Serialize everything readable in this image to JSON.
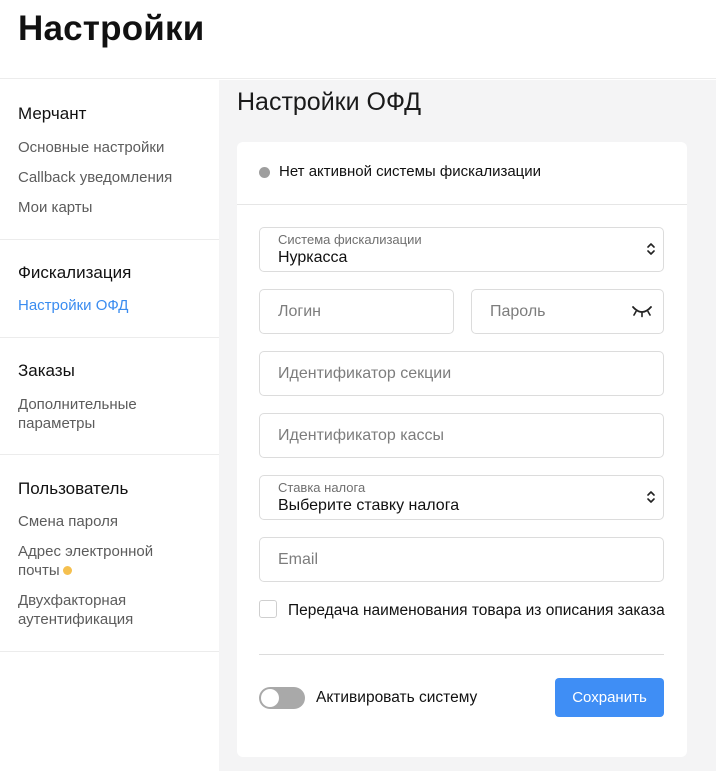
{
  "header": {
    "title": "Настройки"
  },
  "sidebar": {
    "sections": [
      {
        "heading": "Мерчант",
        "items": [
          "Основные настройки",
          "Callback уведомления",
          "Мои карты"
        ]
      },
      {
        "heading": "Фискализация",
        "items": [
          "Настройки ОФД"
        ]
      },
      {
        "heading": "Заказы",
        "items": [
          "Дополнительные параметры"
        ]
      },
      {
        "heading": "Пользователь",
        "items": [
          "Смена пароля",
          "Адрес электронной почты",
          "Двухфакторная аутентификация"
        ]
      }
    ],
    "active_item": "Настройки ОФД",
    "item_lines": {
      "zakazy_1_l1": "Дополнительные",
      "zakazy_1_l2": "параметры",
      "email_l1": "Адрес электронной",
      "email_l2": "почты",
      "twofa_l1": "Двухфакторная",
      "twofa_l2": "аутентификация"
    },
    "warning_dot_color": "#f5c04f"
  },
  "main": {
    "title": "Настройки ОФД",
    "status": {
      "text": "Нет активной системы фискализации",
      "dot_color": "#9e9e9e"
    },
    "form": {
      "fiscal_system": {
        "label": "Система фискализации",
        "value": "Нуркасса"
      },
      "login": {
        "placeholder": "Логин"
      },
      "password": {
        "placeholder": "Пароль"
      },
      "section_id": {
        "placeholder": "Идентификатор секции"
      },
      "cashbox_id": {
        "placeholder": "Идентификатор кассы"
      },
      "tax_rate": {
        "label": "Ставка налога",
        "value": "Выберите ставку налога"
      },
      "email": {
        "placeholder": "Email"
      },
      "pass_name_checkbox": {
        "label": "Передача наименования товара из описания заказа",
        "checked": false
      },
      "activate_toggle": {
        "label": "Активировать систему",
        "on": false
      },
      "save_button": "Сохранить"
    }
  },
  "colors": {
    "accent": "#3f8ef5",
    "active_link": "#3a8cf0"
  }
}
